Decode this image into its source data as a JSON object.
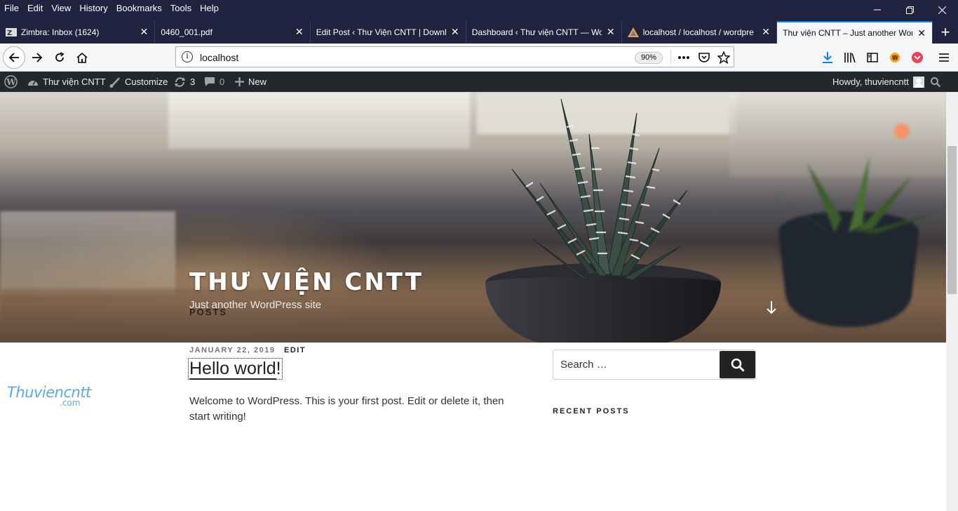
{
  "menubar": {
    "items": [
      "File",
      "Edit",
      "View",
      "History",
      "Bookmarks",
      "Tools",
      "Help"
    ]
  },
  "tabs": [
    {
      "title": "Zimbra: Inbox (1624)",
      "icon": "zimbra-icon"
    },
    {
      "title": "0460_001.pdf",
      "icon": "pdf-icon"
    },
    {
      "title": "Edit Post ‹ Thư Viện CNTT | Downlo",
      "icon": "wordpress-icon"
    },
    {
      "title": "Dashboard ‹ Thư viện CNTT — Wo",
      "icon": "wordpress-icon"
    },
    {
      "title": "localhost / localhost / wordpre",
      "icon": "phpmyadmin-icon"
    },
    {
      "title": "Thư viện CNTT – Just another Wor",
      "icon": "wordpress-icon",
      "active": true
    }
  ],
  "urlbar": {
    "url": "localhost",
    "zoom": "90%"
  },
  "adminbar": {
    "site_name": "Thư viện CNTT",
    "customize": "Customize",
    "updates": "3",
    "comments": "0",
    "new": "New",
    "howdy": "Howdy, thuviencntt"
  },
  "hero": {
    "site_title": "THƯ VIỆN CNTT",
    "tagline": "Just another WordPress site"
  },
  "content": {
    "section_title": "POSTS",
    "post": {
      "date": "JANUARY 22, 2019",
      "edit": "EDIT",
      "title": "Hello world!",
      "excerpt": "Welcome to WordPress. This is your first post. Edit or delete it, then start writing!"
    }
  },
  "sidebar": {
    "search_placeholder": "Search …",
    "recent_posts_title": "RECENT POSTS"
  },
  "watermark": {
    "main": "Thuviencntt",
    "sub": ".com"
  },
  "colors": {
    "chrome_dark": "#202340",
    "adminbar": "#23282d",
    "accent": "#0a84ff"
  }
}
